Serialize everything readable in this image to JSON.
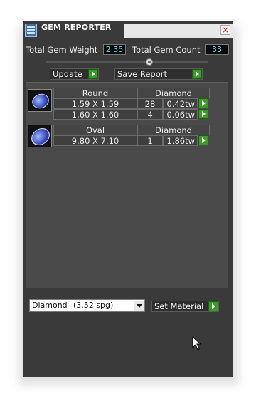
{
  "window": {
    "title": "GEM REPORTER",
    "close_symbol": "×"
  },
  "stats": {
    "weight_label": "Total Gem Weight",
    "weight_value": "2.35",
    "count_label": "Total Gem Count",
    "count_value": "33"
  },
  "slider": {
    "position_fraction": 0.64
  },
  "toolbar": {
    "update_label": "Update",
    "save_label": "Save Report"
  },
  "groups": [
    {
      "shape": "Round",
      "material": "Diamond",
      "rows": [
        {
          "size": "1.59 X 1.59",
          "count": "28",
          "weight": "0.42tw"
        },
        {
          "size": "1.60 X 1.60",
          "count": "4",
          "weight": "0.06tw"
        }
      ]
    },
    {
      "shape": "Oval",
      "material": "Diamond",
      "rows": [
        {
          "size": "9.80 X 7.10",
          "count": "1",
          "weight": "1.86tw"
        }
      ]
    }
  ],
  "material_select": {
    "value": "Diamond",
    "spg": "(3.52 spg)"
  },
  "set_material_label": "Set Material",
  "colors": {
    "panel": "#3a3a3a",
    "accent_green": "#3a9b28",
    "value_cyan": "#57d4f0"
  },
  "icons": [
    "app-icon",
    "close-icon",
    "go-arrow-icon",
    "round-gem-icon",
    "oval-gem-icon",
    "dropdown-arrow-icon",
    "mouse-cursor-icon"
  ]
}
